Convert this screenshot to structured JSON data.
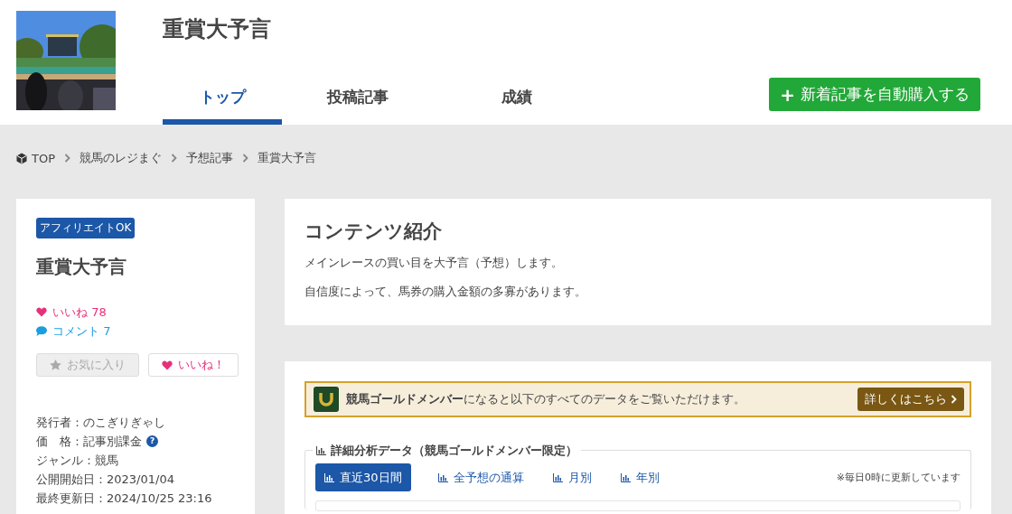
{
  "header": {
    "title": "重賞大予言",
    "tabs": [
      {
        "label": "トップ",
        "selected": true
      },
      {
        "label": "投稿記事",
        "selected": false
      },
      {
        "label": "成績",
        "selected": false
      }
    ],
    "subscribe_button": {
      "icon": "+",
      "label": "新着記事を自動購入する"
    }
  },
  "breadcrumb": [
    {
      "label": "TOP",
      "kind": "home"
    },
    {
      "label": "競馬のレジまぐ",
      "kind": "link"
    },
    {
      "label": "予想記事",
      "kind": "link"
    },
    {
      "label": "重賞大予言",
      "kind": "current"
    }
  ],
  "sidebar": {
    "badge": "アフィリエイトOK",
    "title": "重賞大予言",
    "stats": [
      {
        "kind": "like",
        "label": "いいね 78"
      },
      {
        "kind": "comment",
        "label": "コメント 7"
      }
    ],
    "buttons": [
      {
        "kind": "favorite",
        "label": "お気に入り",
        "disabled": true
      },
      {
        "kind": "like",
        "label": "いいね！",
        "disabled": false
      }
    ],
    "info": [
      {
        "label": "発行者：のこぎりぎゃし"
      },
      {
        "label": "価　格：記事別課金",
        "help_icon": "?"
      },
      {
        "label": "ジャンル：競馬"
      },
      {
        "label": "公開開始日：2023/01/04"
      },
      {
        "label": "最終更新日：2024/10/25 23:16"
      }
    ]
  },
  "intro": {
    "heading": "コンテンツ紹介",
    "paragraphs": [
      "メインレースの買い目を大予言（予想）します。",
      "自信度によって、馬券の購入金額の多寡があります。"
    ]
  },
  "member_banner": {
    "text": "**競馬ゴールドメンバー**になると以下のすべてのデータをご覧いただけます。",
    "button": "詳しくはこちら"
  },
  "analysis": {
    "title": "詳細分析データ（競馬ゴールドメンバー限定）",
    "note": "※毎日0時に更新しています",
    "tabs": [
      {
        "label": "直近30日間",
        "selected": true
      },
      {
        "label": "全予想の通算",
        "selected": false
      },
      {
        "label": "月別",
        "selected": false
      },
      {
        "label": "年別",
        "selected": false
      }
    ]
  }
}
